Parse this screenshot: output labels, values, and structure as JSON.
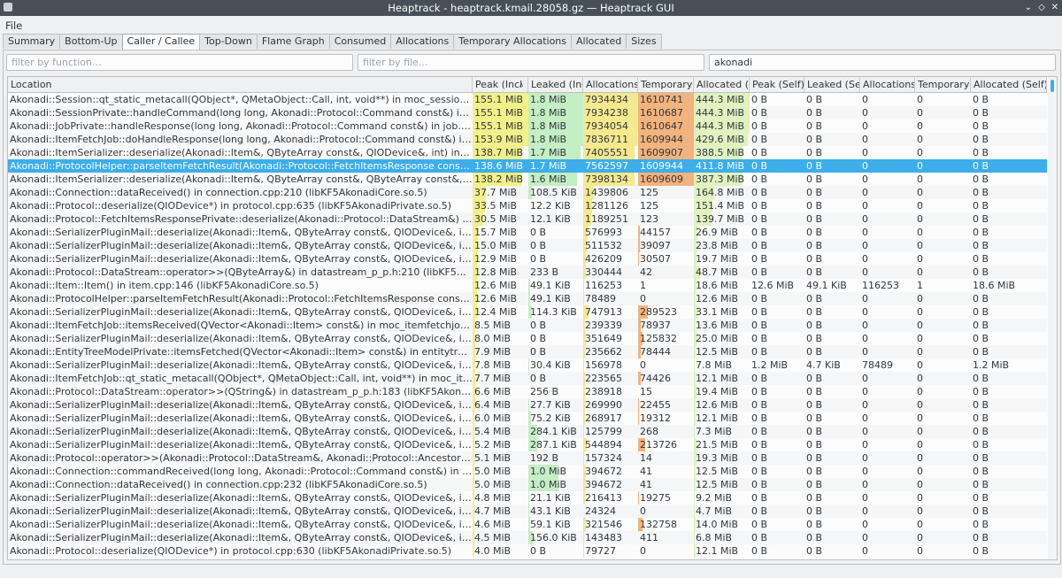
{
  "window": {
    "title": "Heaptrack - heaptrack.kmail.28058.gz — Heaptrack GUI"
  },
  "menu": {
    "file": "File"
  },
  "tabs": [
    "Summary",
    "Bottom-Up",
    "Caller / Callee",
    "Top-Down",
    "Flame Graph",
    "Consumed",
    "Allocations",
    "Temporary Allocations",
    "Allocated",
    "Sizes"
  ],
  "active_tab": 2,
  "filters": {
    "function": {
      "placeholder": "filter by function...",
      "value": ""
    },
    "file": {
      "placeholder": "filter by file...",
      "value": ""
    },
    "module": {
      "placeholder": "",
      "value": "akonadi"
    }
  },
  "colors": {
    "selection": "#3daee9",
    "peak": "#f1f08a",
    "leaked": "#c4eec4",
    "allocations": "#f4e98e",
    "temporary": "#f3b37e",
    "allocated": "#dff2bf"
  },
  "table": {
    "columns": [
      "Location",
      "Peak (Incl",
      "Leaked (Inc",
      "Allocations",
      "Temporary",
      "Allocated (In",
      "Peak (Self)",
      "Leaked (Sel",
      "Allocations",
      "Temporary",
      "Allocated (Self)"
    ],
    "sorted_column": 1,
    "selected_row": 5,
    "rows": [
      [
        "Akonadi::Session::qt_static_metacall(QObject*, QMetaObject::Call, int, void**) in moc_session.cpp:117 (libKF...",
        "155.1 MiB",
        "1.8 MiB",
        "7934434",
        "1610741",
        "444.3 MiB",
        "0 B",
        "0 B",
        "0",
        "0",
        "0 B"
      ],
      [
        "Akonadi::SessionPrivate::handleCommand(long long, Akonadi::Protocol::Command const&) in session.cpp:13...",
        "155.1 MiB",
        "1.8 MiB",
        "7934238",
        "1610687",
        "444.3 MiB",
        "0 B",
        "0 B",
        "0",
        "0",
        "0 B"
      ],
      [
        "Akonadi::JobPrivate::handleResponse(long long, Akonadi::Protocol::Command const&) in job.cpp:80 (libKF5A...",
        "155.1 MiB",
        "1.8 MiB",
        "7934054",
        "1610647",
        "444.3 MiB",
        "0 B",
        "0 B",
        "0",
        "0",
        "0 B"
      ],
      [
        "Akonadi::ItemFetchJob::doHandleResponse(long long, Akonadi::Protocol::Command const&) in itemfetchjob....",
        "153.9 MiB",
        "1.8 MiB",
        "7836711",
        "1609944",
        "429.6 MiB",
        "0 B",
        "0 B",
        "0",
        "0",
        "0 B"
      ],
      [
        "Akonadi::ItemSerializer::deserialize(Akonadi::Item&, QByteArray const&, QIODevice&, int) in itemserializer.c...",
        "138.7 MiB",
        "1.7 MiB",
        "7405551",
        "1609907",
        "388.5 MiB",
        "0 B",
        "0 B",
        "0",
        "0",
        "0 B"
      ],
      [
        "Akonadi::ProtocolHelper::parseItemFetchResult(Akonadi::Protocol::FetchItemsResponse const&, Akonadi::Pr...",
        "138.6 MiB",
        "1.7 MiB",
        "7562597",
        "1609944",
        "411.8 MiB",
        "0 B",
        "0 B",
        "0",
        "0",
        "0 B"
      ],
      [
        "Akonadi::ItemSerializer::deserialize(Akonadi::Item&, QByteArray const&, QByteArray const&, int, bool) in ite...",
        "138.2 MiB",
        "1.6 MiB",
        "7398134",
        "1609609",
        "387.3 MiB",
        "0 B",
        "0 B",
        "0",
        "0",
        "0 B"
      ],
      [
        "Akonadi::Connection::dataReceived() in connection.cpp:210 (libKF5AkonadiCore.so.5)",
        "37.7 MiB",
        "108.5 KiB",
        "1439806",
        "125",
        "164.8 MiB",
        "0 B",
        "0 B",
        "0",
        "0",
        "0 B"
      ],
      [
        "Akonadi::Protocol::deserialize(QIODevice*) in protocol.cpp:635 (libKF5AkonadiPrivate.so.5)",
        "33.5 MiB",
        "12.2 KiB",
        "1281126",
        "125",
        "151.4 MiB",
        "0 B",
        "0 B",
        "0",
        "0",
        "0 B"
      ],
      [
        "Akonadi::Protocol::FetchItemsResponsePrivate::deserialize(Akonadi::Protocol::DataStream&) in protocol.cpp:...",
        "30.5 MiB",
        "12.1 KiB",
        "1189251",
        "123",
        "139.7 MiB",
        "0 B",
        "0 B",
        "0",
        "0",
        "0 B"
      ],
      [
        "Akonadi::SerializerPluginMail::deserialize(Akonadi::Item&, QByteArray const&, QIODevice&, int) in akonadi_s...",
        "15.7 MiB",
        "0 B",
        "576993",
        "44157",
        "26.9 MiB",
        "0 B",
        "0 B",
        "0",
        "0",
        "0 B"
      ],
      [
        "Akonadi::SerializerPluginMail::deserialize(Akonadi::Item&, QByteArray const&, QIODevice&, int) in akonadi_s...",
        "15.0 MiB",
        "0 B",
        "511532",
        "39097",
        "23.8 MiB",
        "0 B",
        "0 B",
        "0",
        "0",
        "0 B"
      ],
      [
        "Akonadi::SerializerPluginMail::deserialize(Akonadi::Item&, QByteArray const&, QIODevice&, int) in akonadi_s...",
        "12.9 MiB",
        "0 B",
        "426209",
        "30507",
        "19.7 MiB",
        "0 B",
        "0 B",
        "0",
        "0",
        "0 B"
      ],
      [
        "Akonadi::Protocol::DataStream::operator>>(QByteArray&) in datastream_p_p.h:210 (libKF5AkonadiPrivate.s...",
        "12.8 MiB",
        "233 B",
        "330444",
        "42",
        "48.7 MiB",
        "0 B",
        "0 B",
        "0",
        "0",
        "0 B"
      ],
      [
        "Akonadi::Item::Item() in item.cpp:146 (libKF5AkonadiCore.so.5)",
        "12.6 MiB",
        "49.1 KiB",
        "116253",
        "1",
        "18.6 MiB",
        "12.6 MiB",
        "49.1 KiB",
        "116253",
        "1",
        "18.6 MiB"
      ],
      [
        "Akonadi::ProtocolHelper::parseItemFetchResult(Akonadi::Protocol::FetchItemsResponse const&, Akonadi::Pr...",
        "12.6 MiB",
        "49.1 KiB",
        "78489",
        "0",
        "12.6 MiB",
        "0 B",
        "0 B",
        "0",
        "0",
        "0 B"
      ],
      [
        "Akonadi::SerializerPluginMail::deserialize(Akonadi::Item&, QByteArray const&, QIODevice&, int) in akonadi_s...",
        "12.4 MiB",
        "114.3 KiB",
        "747913",
        "289523",
        "33.1 MiB",
        "0 B",
        "0 B",
        "0",
        "0",
        "0 B"
      ],
      [
        "Akonadi::ItemFetchJob::itemsReceived(QVector<Akonadi::Item> const&) in moc_itemfetchjob.cpp:164 (libKF...",
        "8.5 MiB",
        "0 B",
        "239339",
        "78937",
        "13.6 MiB",
        "0 B",
        "0 B",
        "0",
        "0",
        "0 B"
      ],
      [
        "Akonadi::SerializerPluginMail::deserialize(Akonadi::Item&, QByteArray const&, QIODevice&, int) in akonadi_s...",
        "8.0 MiB",
        "0 B",
        "351649",
        "125832",
        "25.0 MiB",
        "0 B",
        "0 B",
        "0",
        "0",
        "0 B"
      ],
      [
        "Akonadi::EntityTreeModelPrivate::itemsFetched(QVector<Akonadi::Item> const&) in entitytreemodel_p.cpp:...",
        "7.9 MiB",
        "0 B",
        "235662",
        "78444",
        "12.5 MiB",
        "0 B",
        "0 B",
        "0",
        "0",
        "0 B"
      ],
      [
        "Akonadi::SerializerPluginMail::deserialize(Akonadi::Item&, QByteArray const&, QIODevice&, int) in akonadi_s...",
        "7.8 MiB",
        "30.4 KiB",
        "156978",
        "0",
        "7.8 MiB",
        "1.2 MiB",
        "4.7 KiB",
        "78489",
        "0",
        "1.2 MiB"
      ],
      [
        "Akonadi::ItemFetchJob::qt_static_metacall(QObject*, QMetaObject::Call, int, void**) in moc_itemfetchjob.cpp...",
        "7.7 MiB",
        "0 B",
        "223565",
        "74426",
        "12.1 MiB",
        "0 B",
        "0 B",
        "0",
        "0",
        "0 B"
      ],
      [
        "Akonadi::Protocol::DataStream::operator>>(QString&) in datastream_p_p.h:183 (libKF5AkonadiPrivate.so.5)",
        "6.6 MiB",
        "256 B",
        "238918",
        "15",
        "19.4 MiB",
        "0 B",
        "0 B",
        "0",
        "0",
        "0 B"
      ],
      [
        "Akonadi::SerializerPluginMail::deserialize(Akonadi::Item&, QByteArray const&, QIODevice&, int) in akonadi_s...",
        "6.4 MiB",
        "27.7 KiB",
        "269990",
        "22455",
        "12.6 MiB",
        "0 B",
        "0 B",
        "0",
        "0",
        "0 B"
      ],
      [
        "Akonadi::SerializerPluginMail::deserialize(Akonadi::Item&, QByteArray const&, QIODevice&, int) in akonadi_s...",
        "6.0 MiB",
        "75.2 KiB",
        "268917",
        "19312",
        "12.1 MiB",
        "0 B",
        "0 B",
        "0",
        "0",
        "0 B"
      ],
      [
        "Akonadi::SerializerPluginMail::deserialize(Akonadi::Item&, QByteArray const&, QIODevice&, int) in akonadi_s...",
        "5.4 MiB",
        "284.1 KiB",
        "125799",
        "268",
        "7.3 MiB",
        "0 B",
        "0 B",
        "0",
        "0",
        "0 B"
      ],
      [
        "Akonadi::SerializerPluginMail::deserialize(Akonadi::Item&, QByteArray const&, QIODevice&, int) in akonadi_s...",
        "5.2 MiB",
        "287.1 KiB",
        "544894",
        "213726",
        "21.5 MiB",
        "0 B",
        "0 B",
        "0",
        "0",
        "0 B"
      ],
      [
        "Akonadi::Protocol::operator>>(Akonadi::Protocol::DataStream&, Akonadi::Protocol::Ancestor&) in protocol.c...",
        "5.1 MiB",
        "192 B",
        "157324",
        "14",
        "19.3 MiB",
        "0 B",
        "0 B",
        "0",
        "0",
        "0 B"
      ],
      [
        "Akonadi::Connection::commandReceived(long long, Akonadi::Protocol::Command const&) in moc_connectio...",
        "5.0 MiB",
        "1.0 MiB",
        "394672",
        "41",
        "12.5 MiB",
        "0 B",
        "0 B",
        "0",
        "0",
        "0 B"
      ],
      [
        "Akonadi::Connection::dataReceived() in connection.cpp:232 (libKF5AkonadiCore.so.5)",
        "5.0 MiB",
        "1.0 MiB",
        "394672",
        "41",
        "12.5 MiB",
        "0 B",
        "0 B",
        "0",
        "0",
        "0 B"
      ],
      [
        "Akonadi::SerializerPluginMail::deserialize(Akonadi::Item&, QByteArray const&, QIODevice&, int) in akonadi_s...",
        "4.8 MiB",
        "21.1 KiB",
        "216413",
        "19275",
        "9.2 MiB",
        "0 B",
        "0 B",
        "0",
        "0",
        "0 B"
      ],
      [
        "Akonadi::SerializerPluginMail::deserialize(Akonadi::Item&, QByteArray const&, QIODevice&, int) in akonadi_s...",
        "4.7 MiB",
        "43.1 KiB",
        "24324",
        "0",
        "4.7 MiB",
        "0 B",
        "0 B",
        "0",
        "0",
        "0 B"
      ],
      [
        "Akonadi::SerializerPluginMail::deserialize(Akonadi::Item&, QByteArray const&, QIODevice&, int) in akonadi_s...",
        "4.6 MiB",
        "59.1 KiB",
        "321546",
        "132758",
        "14.0 MiB",
        "0 B",
        "0 B",
        "0",
        "0",
        "0 B"
      ],
      [
        "Akonadi::SerializerPluginMail::deserialize(Akonadi::Item&, QByteArray const&, QIODevice&, int) in akonadi_s...",
        "4.5 MiB",
        "156.0 KiB",
        "143483",
        "411",
        "6.8 MiB",
        "0 B",
        "0 B",
        "0",
        "0",
        "0 B"
      ],
      [
        "Akonadi::Protocol::deserialize(QIODevice*) in protocol.cpp:630 (libKF5AkonadiPrivate.so.5)",
        "4.0 MiB",
        "0 B",
        "79727",
        "0",
        "12.1 MiB",
        "0 B",
        "0 B",
        "0",
        "0",
        "0 B"
      ]
    ]
  }
}
